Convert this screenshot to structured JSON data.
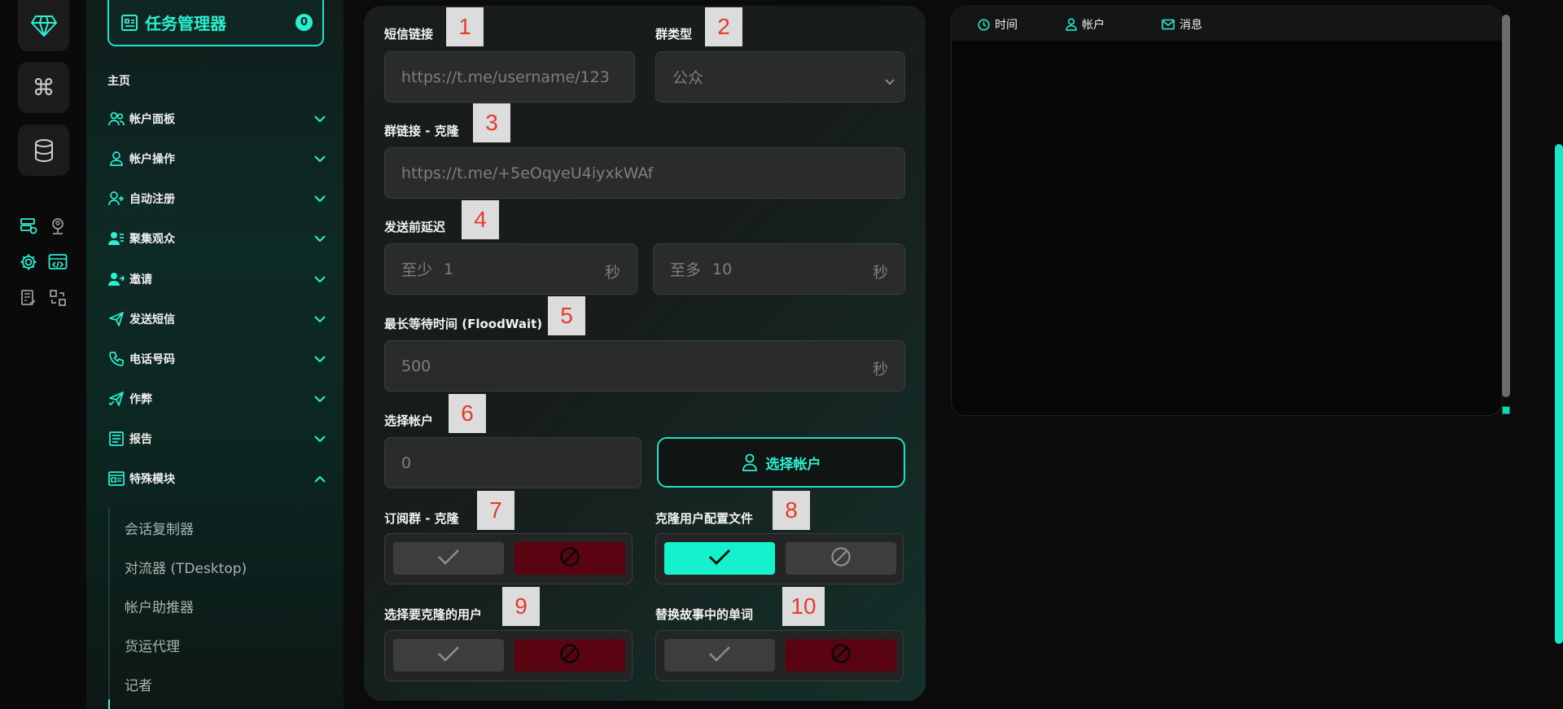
{
  "sidebar": {
    "task_manager_label": "任务管理器",
    "task_manager_count": "0",
    "home_label": "主页",
    "items": [
      {
        "label": "帐户面板",
        "icon": "users-icon"
      },
      {
        "label": "帐户操作",
        "icon": "user-icon"
      },
      {
        "label": "自动注册",
        "icon": "user-plus-icon"
      },
      {
        "label": "聚集观众",
        "icon": "users-group-icon"
      },
      {
        "label": "邀请",
        "icon": "user-invite-icon"
      },
      {
        "label": "发送短信",
        "icon": "send-icon"
      },
      {
        "label": "电话号码",
        "icon": "phone-icon"
      },
      {
        "label": "作弊",
        "icon": "send-check-icon"
      },
      {
        "label": "报告",
        "icon": "report-icon"
      },
      {
        "label": "特殊模块",
        "icon": "module-icon"
      }
    ],
    "sub_items": [
      "会话复制器",
      "对流器 (TDesktop)",
      "帐户助推器",
      "货运代理",
      "记者"
    ]
  },
  "form": {
    "sms_link": {
      "label": "短信链接",
      "number": "1",
      "placeholder": "https://t.me/username/123"
    },
    "group_type": {
      "label": "群类型",
      "number": "2",
      "value": "公众"
    },
    "group_link": {
      "label": "群链接 - 克隆",
      "number": "3",
      "placeholder": "https://t.me/+5eOqyeU4iyxkWAf"
    },
    "delay": {
      "label": "发送前延迟",
      "number": "4",
      "min_label": "至少",
      "min_value": "1",
      "max_label": "至多",
      "max_value": "10",
      "unit": "秒"
    },
    "flood_wait": {
      "label": "最长等待时间 (FloodWait)",
      "number": "5",
      "value": "500",
      "unit": "秒"
    },
    "select_account": {
      "label": "选择帐户",
      "number": "6",
      "value": "0",
      "button_label": "选择帐户"
    },
    "subscribe_clone": {
      "label": "订阅群 - 克隆",
      "number": "7",
      "enabled": false
    },
    "clone_profile": {
      "label": "克隆用户配置文件",
      "number": "8",
      "enabled": true
    },
    "select_clone_users": {
      "label": "选择要克隆的用户",
      "number": "9",
      "enabled": false
    },
    "replace_story_words": {
      "label": "替换故事中的单词",
      "number": "10",
      "enabled": false
    }
  },
  "log": {
    "columns": [
      "时间",
      "帐户",
      "消息"
    ]
  },
  "colors": {
    "accent": "#16f1cd",
    "danger": "#5a0412",
    "panel": "#1a1d1d"
  }
}
